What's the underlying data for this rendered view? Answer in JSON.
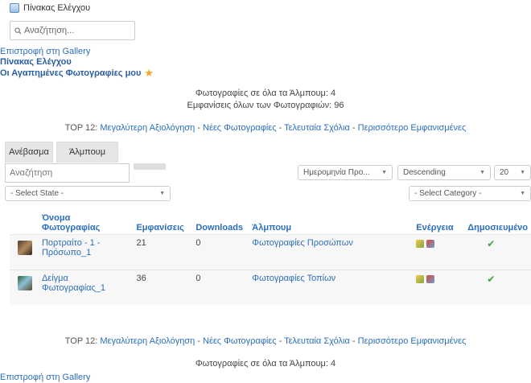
{
  "header": {
    "title": "Πίνακας Ελέγχου"
  },
  "search": {
    "placeholder": "Αναζήτηση..."
  },
  "nav": {
    "back": "Επιστροφή στη Gallery",
    "dashboard": "Πίνακας Ελέγχου",
    "favorites": "Οι Αγαπημένες Φωτογραφίες μου"
  },
  "stats": {
    "photos_in_albums": "Φωτογραφίες σε όλα τα Άλμπουμ: 4",
    "views_all": "Εμφανίσεις όλων των Φωτογραφιών: 96"
  },
  "top12": {
    "prefix": "TOP 12:",
    "links": [
      "Μεγαλύτερη Αξιολόγηση",
      "Νέες Φωτογραφίες",
      "Τελευταία Σχόλια",
      "Περισσότερο Εμφανισμένες"
    ],
    "sep": " - "
  },
  "tabs": [
    "Ανέβασμα",
    "Άλμπουμ"
  ],
  "filters": {
    "search_placeholder": "Αναζήτηση",
    "sort_field": "Ημερομηνία Προ...",
    "sort_dir": "Descending",
    "limit": "20",
    "state": "- Select State -",
    "category": "- Select Category -"
  },
  "table": {
    "headers": [
      "Όνομα Φωτογραφίας",
      "Εμφανίσεις",
      "Downloads",
      "Άλμπουμ",
      "Ενέργεια",
      "Δημοσιευμένο"
    ],
    "rows": [
      {
        "name": "Πορτραίτο - 1 - Πρόσωπο_1",
        "views": "21",
        "downloads": "0",
        "album": "Φωτογραφίες Προσώπων",
        "published": "✔"
      },
      {
        "name": "Δείγμα Φωτογραφίας_1",
        "views": "36",
        "downloads": "0",
        "album": "Φωτογραφίες Τοπίων",
        "published": "✔"
      }
    ]
  },
  "footer": {
    "photos_in_albums": "Φωτογραφίες σε όλα τα Άλμπουμ: 4",
    "back": "Επιστροφή στη Gallery"
  },
  "icons": [
    "dashboard-icon",
    "search-icon",
    "star-icon",
    "edit-icon",
    "delete-icon",
    "check-icon"
  ],
  "colors": {
    "link": "#2a6ebb",
    "tab_bg": "#e6e6e6",
    "check": "#3aa53a",
    "star": "#f5a623"
  }
}
